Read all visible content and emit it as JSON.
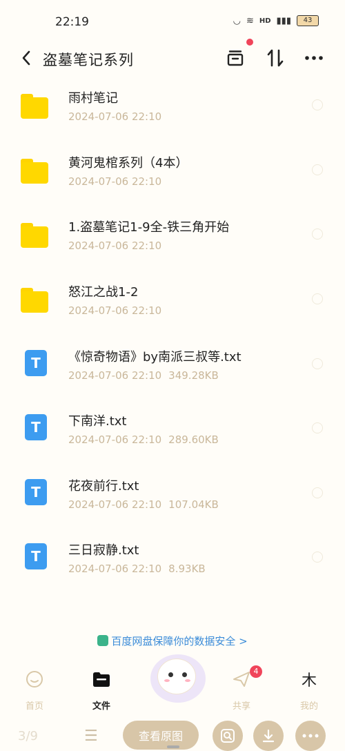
{
  "status_bar": {
    "time": "22:19",
    "battery": "43",
    "indicators": [
      "HD"
    ]
  },
  "header": {
    "title": "盗墓笔记系列",
    "icons": [
      "back-icon",
      "archive-icon",
      "sort-icon",
      "more-icon"
    ]
  },
  "files": [
    {
      "type": "folder",
      "name": "雨村笔记",
      "date": "2024-07-06  22:10",
      "size": ""
    },
    {
      "type": "folder",
      "name": "黄河鬼棺系列（4本）",
      "date": "2024-07-06  22:10",
      "size": ""
    },
    {
      "type": "folder",
      "name": "1.盗墓笔记1-9全-铁三角开始",
      "date": "2024-07-06  22:10",
      "size": ""
    },
    {
      "type": "folder",
      "name": "怒江之战1-2",
      "date": "2024-07-06  22:10",
      "size": ""
    },
    {
      "type": "txt",
      "name": "《惊奇物语》by南派三叔等.txt",
      "date": "2024-07-06  22:10",
      "size": "349.28KB"
    },
    {
      "type": "txt",
      "name": "下南洋.txt",
      "date": "2024-07-06  22:10",
      "size": "289.60KB"
    },
    {
      "type": "txt",
      "name": "花夜前行.txt",
      "date": "2024-07-06  22:10",
      "size": "107.04KB"
    },
    {
      "type": "txt",
      "name": "三日寂静.txt",
      "date": "2024-07-06  22:10",
      "size": "8.93KB"
    }
  ],
  "txt_icon_letter": "T",
  "safety_banner": "百度网盘保障你的数据安全",
  "safety_chevron": ">",
  "tabbar": {
    "home": "首页",
    "files": "文件",
    "share": "共享",
    "mine": "我的",
    "share_badge": "4"
  },
  "bottom_bar": {
    "page_count": "3/9",
    "view_original": "查看原图"
  },
  "colors": {
    "folder": "#ffd800",
    "txt_icon": "#3d9cf0",
    "meta_text": "#c9b79a",
    "banner_text": "#3a8bd8",
    "badge": "#f0445a",
    "bottom_button": "#d8c6a8"
  }
}
